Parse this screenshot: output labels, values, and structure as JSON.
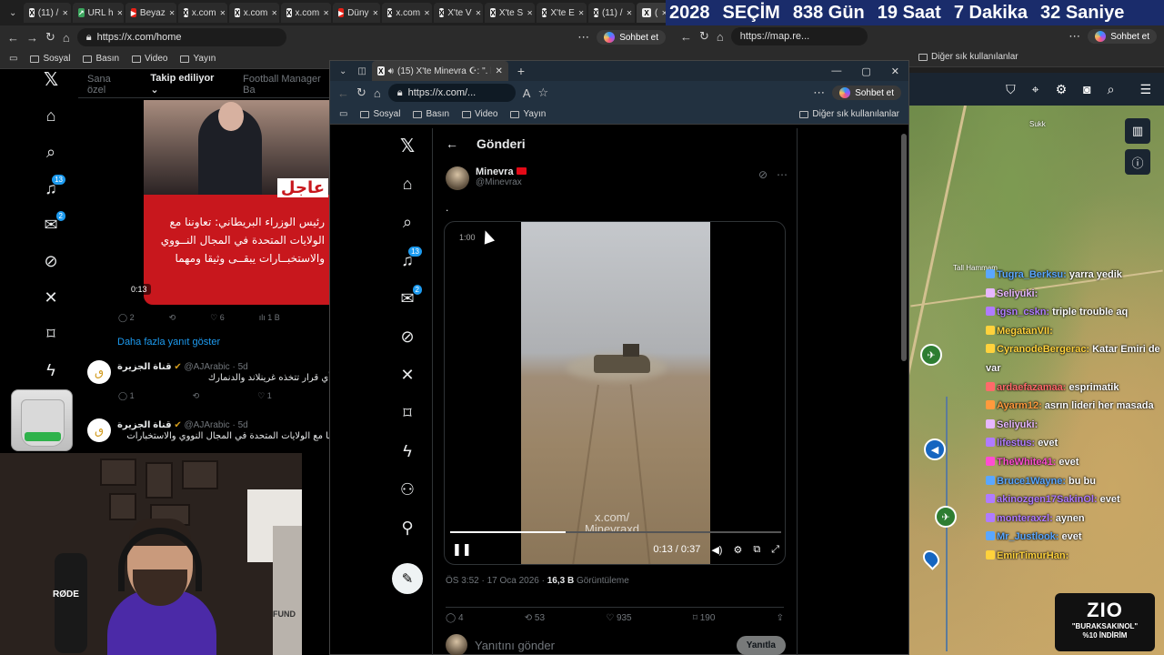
{
  "back_browser": {
    "tabs": [
      {
        "label": "(11) /",
        "icon": "x"
      },
      {
        "label": "URL h",
        "icon": "g"
      },
      {
        "label": "Beyaz",
        "icon": "yt"
      },
      {
        "label": "x.com",
        "icon": "x"
      },
      {
        "label": "x.com",
        "icon": "x"
      },
      {
        "label": "x.com",
        "icon": "x"
      },
      {
        "label": "Düny",
        "icon": "yt"
      },
      {
        "label": "x.com",
        "icon": "x"
      },
      {
        "label": "X'te V",
        "icon": "x"
      },
      {
        "label": "X'te S",
        "icon": "x"
      },
      {
        "label": "X'te E",
        "icon": "x"
      },
      {
        "label": "(11) /",
        "icon": "x"
      },
      {
        "label": "(",
        "icon": "x"
      }
    ],
    "url": "https://x.com/home",
    "copilot": "Sohbet et",
    "bookmarks": [
      "Sosyal",
      "Basın",
      "Video",
      "Yayın"
    ],
    "feed_tabs": [
      "Sana özel",
      "Takip ediliyor",
      "Football Manager Ba"
    ],
    "notif_badge": "13",
    "msg_badge": "2",
    "news_tag": "عاجل",
    "news_text": "رئيس الوزراء البريطاني: تعاوننا مع الولايات المتحدة في المجال النــووي والاستخبــارات يبقــى وثيقا ومهما",
    "video_time": "0:13",
    "stats": [
      "2",
      "",
      "6",
      "1 B"
    ],
    "more_replies": "Daha fazla yanıt göster",
    "replies": [
      {
        "name": "قناة الجزيرة",
        "handle": "@AJArabic · 5d",
        "text": "أي قرار تتخذه غرينلاند والدنمارك",
        "stats": [
          "1",
          "",
          "1"
        ]
      },
      {
        "name": "قناة الجزيرة",
        "handle": "@AJArabic · 5d",
        "text": "نا مع الولايات المتحدة في المجال النووي والاستخبارات",
        "stats": []
      }
    ]
  },
  "webcam": {
    "mic_label": "RØDE",
    "box_text": "FUND",
    "edge_text": "ti"
  },
  "counter": {
    "year": "2028",
    "label": "SEÇİM",
    "days": "838",
    "days_label": "Gün",
    "hours": "19",
    "hours_label": "Saat",
    "minutes": "7",
    "minutes_label": "Dakika",
    "seconds": "32",
    "seconds_label": "Saniye"
  },
  "right_browser": {
    "url": "https://map.re...",
    "copilot": "Sohbet et",
    "bookmarks": [
      "Sosyal",
      "Basın",
      "Video",
      "Yayın"
    ],
    "other_bookmarks": "Diğer sık kullanılanlar",
    "map_labels": [
      "Tall Hammam",
      "Sukk"
    ],
    "chat": [
      {
        "user": "Tugra_Berksu:",
        "msg": "yarra yedik",
        "color": "#5aa7ff"
      },
      {
        "user": "Seliyuki:",
        "msg": "",
        "color": "#e7b7ff"
      },
      {
        "user": "tgsn_cskn:",
        "msg": "triple trouble aq",
        "color": "#b07bff"
      },
      {
        "user": "MegatanVII:",
        "msg": "",
        "color": "#ffd23c"
      },
      {
        "user": "CyranodeBergerac:",
        "msg": "Katar Emiri de var",
        "color": "#ffd23c"
      },
      {
        "user": "ardaefazamaa:",
        "msg": "esprimatik",
        "color": "#ff6a6a"
      },
      {
        "user": "Ayarm12:",
        "msg": "asrın lideri her masada",
        "color": "#ff9a3c"
      },
      {
        "user": "Seliyuki:",
        "msg": "",
        "color": "#e7b7ff"
      },
      {
        "user": "lifestus:",
        "msg": "evet",
        "color": "#b07bff"
      },
      {
        "user": "TheWhite41:",
        "msg": "evet",
        "color": "#ff4dd2"
      },
      {
        "user": "Bruce1Wayne:",
        "msg": "bu bu",
        "color": "#5aa7ff"
      },
      {
        "user": "akinozgen17SakinOl:",
        "msg": "evet",
        "color": "#b07bff"
      },
      {
        "user": "monteraxzl:",
        "msg": "aynen",
        "color": "#b07bff"
      },
      {
        "user": "Mr_Justlook:",
        "msg": "evet",
        "color": "#5aa7ff"
      },
      {
        "user": "EmirTimurHan:",
        "msg": "",
        "color": "#ffd23c"
      }
    ],
    "sponsor": {
      "logo": "ZIO",
      "line1": "\"BURAKSAKINOL\"",
      "line2": "%10 İNDİRİM"
    }
  },
  "front_browser": {
    "tab_title": "(15) X'te Minevra ☪: \". https://",
    "url": "https://x.com/...",
    "copilot": "Sohbet et",
    "bookmarks": [
      "Sosyal",
      "Basın",
      "Video",
      "Yayın"
    ],
    "other_bookmarks": "Diğer sık kullanılanlar",
    "notif_badge": "13",
    "msg_badge": "2",
    "header": "Gönderi",
    "author_name": "Minevra",
    "author_handle": "@Minevrax",
    "post_text": ".",
    "video_overlay": "1:00",
    "watermark_line1": "x.com/",
    "watermark_line2": "Minevraxd",
    "video_time": "0:13 / 0:37",
    "progress": 0.35,
    "post_time": "ÖS 3:52 · 17 Oca 2026 · ",
    "views": "16,3 B",
    "views_label": " Görüntüleme",
    "actions": {
      "replies": "4",
      "reposts": "53",
      "likes": "935",
      "bookmarks": "190"
    },
    "reply_placeholder": "Yanıtını gönder",
    "reply_button": "Yanıtla"
  }
}
